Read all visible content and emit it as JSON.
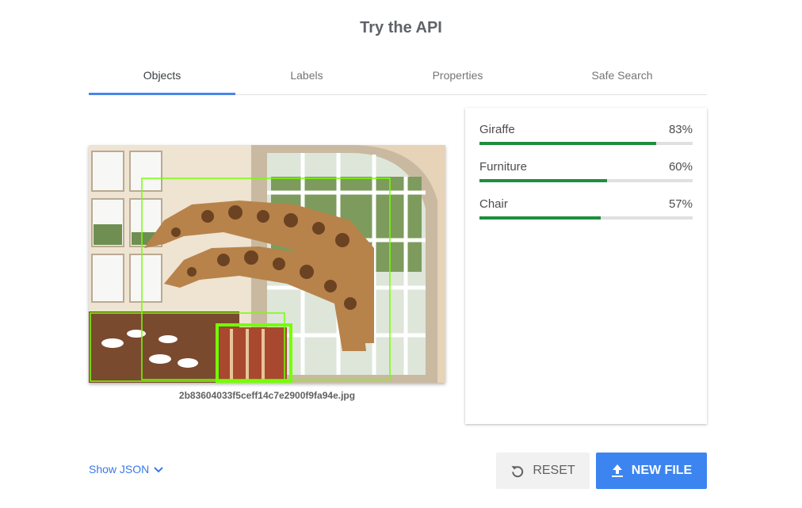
{
  "page": {
    "title": "Try the API"
  },
  "tabs": [
    {
      "label": "Objects",
      "active": true
    },
    {
      "label": "Labels",
      "active": false
    },
    {
      "label": "Properties",
      "active": false
    },
    {
      "label": "Safe Search",
      "active": false
    }
  ],
  "image": {
    "filename": "2b83604033f5ceff14c7e2900f9fa94e.jpg"
  },
  "results": [
    {
      "label": "Giraffe",
      "score_text": "83%",
      "score": 0.83
    },
    {
      "label": "Furniture",
      "score_text": "60%",
      "score": 0.6
    },
    {
      "label": "Chair",
      "score_text": "57%",
      "score": 0.57
    }
  ],
  "footer": {
    "show_json_label": "Show JSON",
    "reset_label": "RESET",
    "new_file_label": "NEW FILE"
  },
  "colors": {
    "accent": "#4a86e8",
    "bar": "#1e8e3e",
    "box": "#76ff03",
    "primary_button": "#3c84f0"
  },
  "icons": {
    "show_json": "chevron-down-icon",
    "reset": "reset-icon",
    "new_file": "upload-icon"
  }
}
